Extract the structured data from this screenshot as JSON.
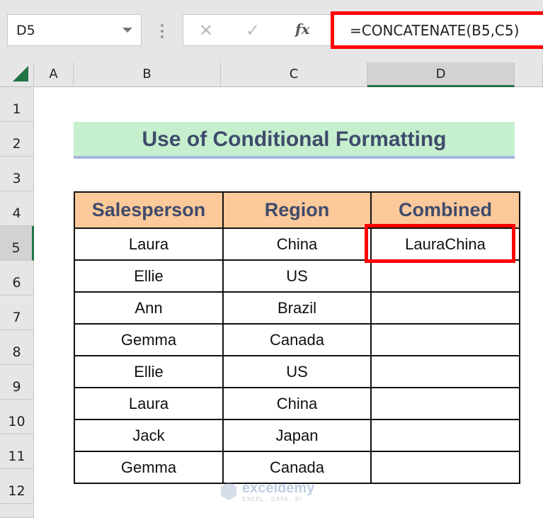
{
  "formula_bar": {
    "name_box": "D5",
    "cancel_icon": "✕",
    "enter_icon": "✓",
    "fx_icon": "fx",
    "formula": "=CONCATENATE(B5,C5)"
  },
  "columns": [
    "A",
    "B",
    "C",
    "D"
  ],
  "selected_column": "D",
  "rows": [
    "1",
    "2",
    "3",
    "4",
    "5",
    "6",
    "7",
    "8",
    "9",
    "10",
    "11",
    "12"
  ],
  "selected_row": "5",
  "sheet": {
    "title": "Use of Conditional Formatting",
    "headers": [
      "Salesperson",
      "Region",
      "Combined"
    ],
    "records": [
      {
        "salesperson": "Laura",
        "region": "China",
        "combined": "LauraChina"
      },
      {
        "salesperson": "Ellie",
        "region": "US",
        "combined": ""
      },
      {
        "salesperson": "Ann",
        "region": "Brazil",
        "combined": ""
      },
      {
        "salesperson": "Gemma",
        "region": "Canada",
        "combined": ""
      },
      {
        "salesperson": "Ellie",
        "region": "US",
        "combined": ""
      },
      {
        "salesperson": "Laura",
        "region": "China",
        "combined": ""
      },
      {
        "salesperson": "Jack",
        "region": "Japan",
        "combined": ""
      },
      {
        "salesperson": "Gemma",
        "region": "Canada",
        "combined": ""
      }
    ]
  },
  "watermark": {
    "name": "exceldemy",
    "tagline": "EXCEL · DATA · BI"
  },
  "colors": {
    "highlight": "#ff0000",
    "title_bg": "#c6efce",
    "header_bg": "#fcc99a",
    "accent": "#217346"
  }
}
